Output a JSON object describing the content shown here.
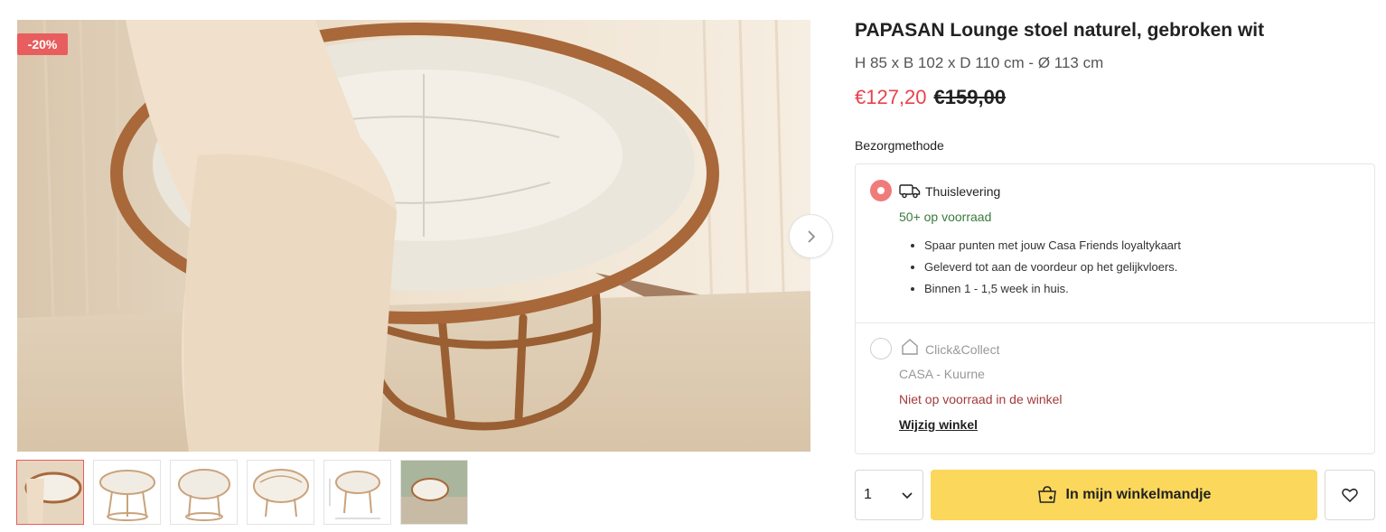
{
  "product": {
    "title": "PAPASAN Lounge stoel naturel, gebroken wit",
    "dimensions": "H 85 x B 102 x D 110 cm - Ø 113 cm",
    "price_new": "€127,20",
    "price_old": "€159,00",
    "discount_badge": "-20%"
  },
  "gallery": {
    "thumbnail_count": 6,
    "active_thumbnail": 1
  },
  "delivery": {
    "label": "Bezorgmethode",
    "home": {
      "title": "Thuislevering",
      "stock": "50+ op voorraad",
      "bullets": [
        "Spaar punten met jouw Casa Friends loyaltykaart",
        "Geleverd tot aan de voordeur op het gelijkvloers.",
        "Binnen 1 - 1,5 week in huis."
      ],
      "selected": true
    },
    "collect": {
      "title": "Click&Collect",
      "store": "CASA - Kuurne",
      "stock": "Niet op voorraad in de winkel",
      "change_link": "Wijzig winkel",
      "selected": false
    }
  },
  "cart": {
    "quantity": "1",
    "add_label": "In mijn winkelmandje"
  },
  "colors": {
    "accent_red": "#e8434c",
    "cart_yellow": "#fbd75b",
    "stock_green": "#3a7a3c",
    "stock_red": "#a33a3a"
  },
  "icons": [
    "truck-icon",
    "house-icon",
    "chevron-right-icon",
    "chevron-down-icon",
    "bag-plus-icon",
    "heart-icon"
  ]
}
